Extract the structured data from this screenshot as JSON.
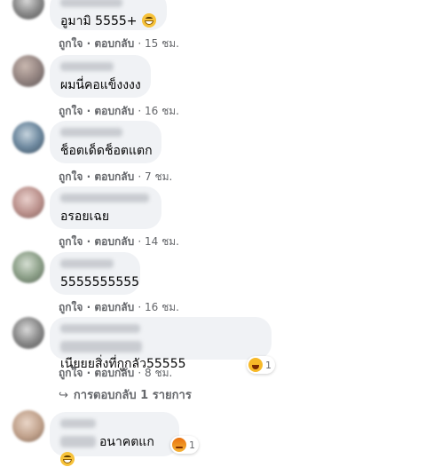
{
  "comments": [
    {
      "text": "อูมามิ 5555+",
      "emoji": "grin-sweat",
      "like": "ถูกใจ",
      "reply": "ตอบกลับ",
      "time": "15 ชม."
    },
    {
      "text": "ผมนี่คอแข็งงงง",
      "like": "ถูกใจ",
      "reply": "ตอบกลับ",
      "time": "16 ชม."
    },
    {
      "text": "ช็อตเด็ดช็อตแตก",
      "like": "ถูกใจ",
      "reply": "ตอบกลับ",
      "time": "7 ชม."
    },
    {
      "text": "อรอยเฉย",
      "like": "ถูกใจ",
      "reply": "ตอบกลับ",
      "time": "14 ชม."
    },
    {
      "text": "5555555555",
      "like": "ถูกใจ",
      "reply": "ตอบกลับ",
      "time": "16 ชม."
    },
    {
      "text": "เนียยยสิ่งที่กูกลัว55555",
      "like": "ถูกใจ",
      "reply": "ตอบกลับ",
      "time": "8 ชม.",
      "reaction_count": "1"
    },
    {
      "text": "อนาคตแก",
      "reaction_count": "1"
    }
  ],
  "replies_link": "การตอบกลับ 1 รายการ",
  "separator": "·"
}
